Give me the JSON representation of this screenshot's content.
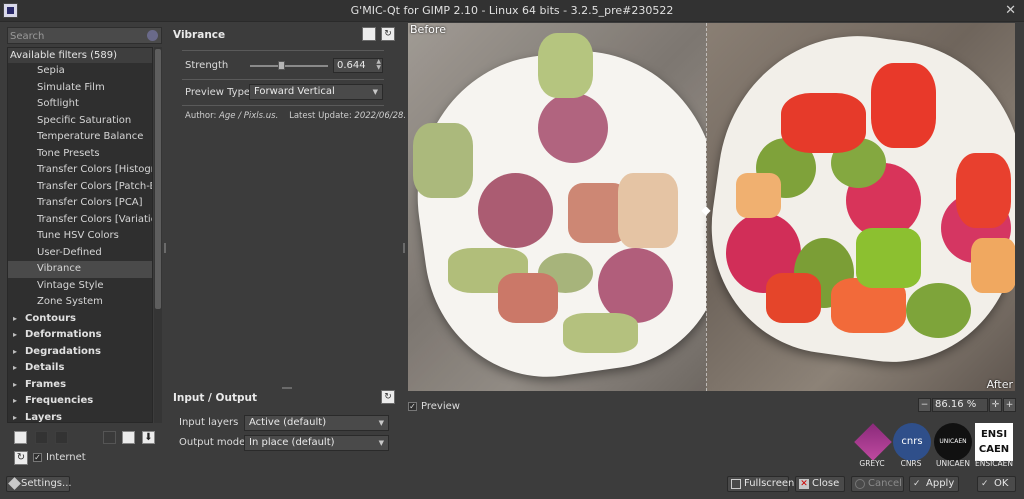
{
  "window": {
    "title": "G'MIC-Qt for GIMP 2.10 - Linux 64 bits - 3.2.5_pre#230522"
  },
  "search": {
    "placeholder": "Search"
  },
  "filters": {
    "header": "Available filters (589)",
    "items": [
      "Sepia",
      "Simulate Film",
      "Softlight",
      "Specific Saturation",
      "Temperature Balance",
      "Tone Presets",
      "Transfer Colors [Histogram]",
      "Transfer Colors [Patch-Based]",
      "Transfer Colors [PCA]",
      "Transfer Colors [Variational]",
      "Tune HSV Colors",
      "User-Defined",
      "Vibrance",
      "Vintage Style",
      "Zone System"
    ],
    "selected": "Vibrance",
    "categories": [
      "Contours",
      "Deformations",
      "Degradations",
      "Details",
      "Frames",
      "Frequencies",
      "Layers"
    ]
  },
  "internet": {
    "label": "Internet",
    "checked": true
  },
  "settings_button": "Settings...",
  "filter_panel": {
    "title": "Vibrance",
    "strength_label": "Strength",
    "strength_value": "0.644",
    "strength_fraction": 0.4,
    "preview_type_label": "Preview Type",
    "preview_type_value": "Forward Vertical",
    "author_prefix": "Author: ",
    "author_name": "Age / Pixls.us.",
    "latest_update_prefix": "Latest Update: ",
    "latest_update_value": "2022/06/28."
  },
  "io": {
    "title": "Input / Output",
    "input_layers_label": "Input layers",
    "input_layers_value": "Active (default)",
    "output_mode_label": "Output mode",
    "output_mode_value": "In place (default)"
  },
  "preview": {
    "before_label": "Before",
    "after_label": "After",
    "checkbox_label": "Preview",
    "checked": true,
    "zoom": "86.16 %"
  },
  "logos": [
    "GREYC",
    "CNRS",
    "UNICAEN",
    "ENSICAEN"
  ],
  "logo_text": {
    "cnrs": "cnrs",
    "unicaen": "UNICAEN",
    "ensicaen_top": "ENSI",
    "ensicaen_bottom": "CAEN"
  },
  "buttons": {
    "fullscreen": "Fullscreen",
    "close": "Close",
    "cancel": "Cancel",
    "apply": "Apply",
    "ok": "OK"
  },
  "colors": {
    "accent": "#3c3c3c",
    "selected": "#4a4a4a",
    "strawberry": "#e63a2a",
    "raspberry": "#d8345a",
    "kiwi": "#8ab23a",
    "grape": "#7fa23a"
  }
}
